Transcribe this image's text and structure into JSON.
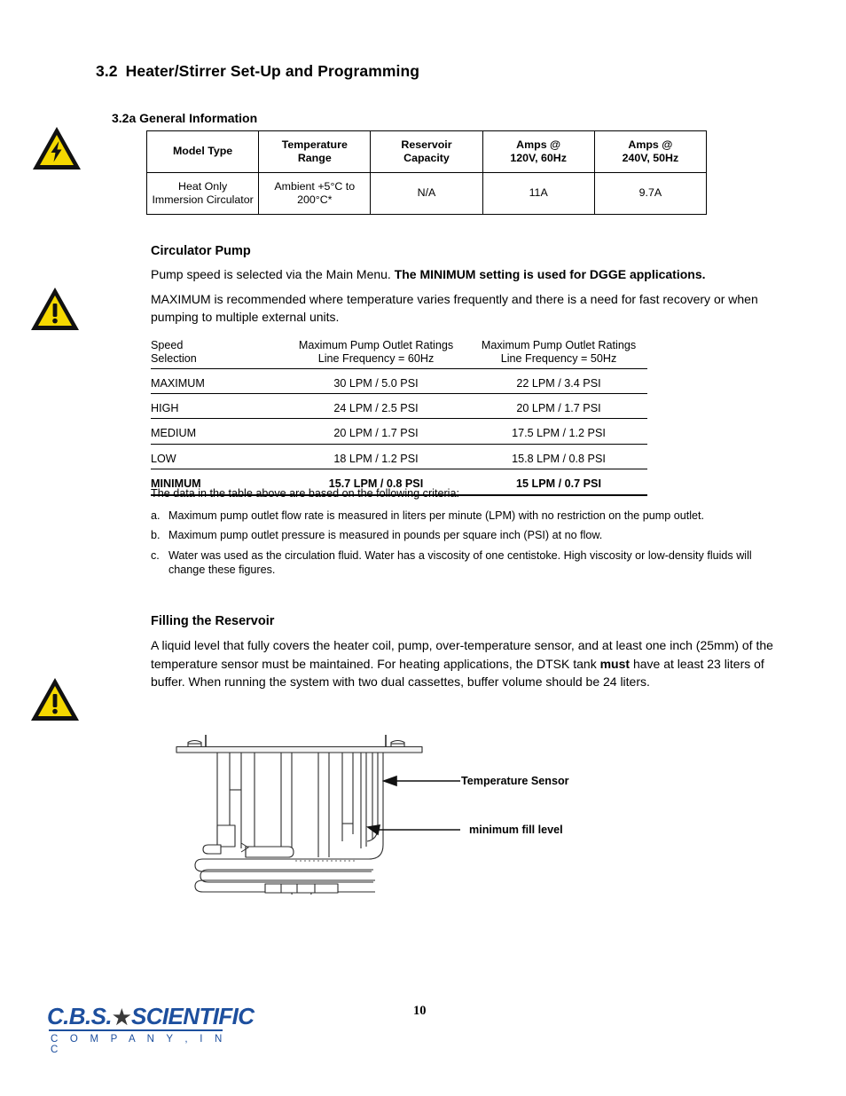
{
  "section": {
    "number": "3.2",
    "title": "Heater/Stirrer Set-Up and Programming",
    "subsection": "3.2a General Information"
  },
  "icons": {
    "electrical_hazard": "high-voltage-warning-icon",
    "general_warning": "exclamation-warning-icon"
  },
  "general_info_table": {
    "headers": [
      "Model Type",
      "Temperature\nRange",
      "Reservoir\nCapacity",
      "Amps @\n120V, 60Hz",
      "Amps @\n240V, 50Hz"
    ],
    "header_lines": [
      [
        "Model Type",
        ""
      ],
      [
        "Temperature",
        "Range"
      ],
      [
        "Reservoir",
        "Capacity"
      ],
      [
        "Amps @",
        "120V, 60Hz"
      ],
      [
        "Amps @",
        "240V, 50Hz"
      ]
    ],
    "rows": [
      {
        "model_line1": "Heat Only",
        "model_line2": "Immersion Circulator",
        "temp_line1": "Ambient +5°C to",
        "temp_line2": "200°C*",
        "reservoir": "N/A",
        "amps_120": "11A",
        "amps_240": "9.7A"
      }
    ]
  },
  "circulator_pump": {
    "heading": "Circulator Pump",
    "para1_normal": "Pump speed is selected via the Main Menu. ",
    "para1_bold": "The MINIMUM setting is used for DGGE applications.",
    "para2": "MAXIMUM is recommended where temperature varies frequently and there is a need for fast recovery or when pumping to multiple external units."
  },
  "pump_table": {
    "header": {
      "col1_line1": "Speed",
      "col1_line2": "Selection",
      "col2_line1": "Maximum Pump Outlet Ratings",
      "col2_line2": "Line Frequency = 60Hz",
      "col3_line1": "Maximum Pump Outlet Ratings",
      "col3_line2": "Line Frequency = 50Hz"
    },
    "rows": [
      {
        "speed": "MAXIMUM",
        "hz60": "30 LPM / 5.0 PSI",
        "hz50": "22 LPM / 3.4 PSI"
      },
      {
        "speed": "HIGH",
        "hz60": "24 LPM / 2.5 PSI",
        "hz50": "20 LPM / 1.7 PSI"
      },
      {
        "speed": "MEDIUM",
        "hz60": "20 LPM / 1.7 PSI",
        "hz50": "17.5 LPM / 1.2 PSI"
      },
      {
        "speed": "LOW",
        "hz60": "18 LPM / 1.2 PSI",
        "hz50": "15.8 LPM / 0.8 PSI"
      },
      {
        "speed": "MINIMUM",
        "hz60": "15.7 LPM / 0.8 PSI",
        "hz50": "15 LPM / 0.7 PSI"
      }
    ]
  },
  "criteria": {
    "intro": "The data in the table above are based on the following criteria:",
    "items": [
      {
        "marker": "a.",
        "text": "Maximum pump outlet flow rate is measured in liters per minute (LPM) with no restriction on the pump outlet."
      },
      {
        "marker": "b.",
        "text": "Maximum pump outlet pressure is measured in pounds per square inch (PSI) at no flow."
      },
      {
        "marker": "c.",
        "text": "Water was used as the circulation fluid. Water has a viscosity of one centistoke. High viscosity or low-density fluids will change these figures."
      }
    ]
  },
  "filling_reservoir": {
    "heading": "Filling the Reservoir",
    "para_part1": "A liquid level that fully covers the heater coil, pump, over-temperature sensor, and at least one inch (25mm) of the temperature sensor must be maintained.   For heating applications, the DTSK tank ",
    "para_bold": "must",
    "para_part2": " have at least 23 liters of buffer.  When running the system with two dual cassettes, buffer volume should be 24 liters."
  },
  "diagram": {
    "labels": {
      "temperature_sensor": "Temperature Sensor",
      "minimum_fill_level": "minimum fill level"
    }
  },
  "footer": {
    "logo_main": "C.B.S.",
    "logo_star": "★",
    "logo_secondary": "SCIENTIFIC",
    "logo_sub": "C O M P A N Y ,   I N C",
    "page_number": "10"
  },
  "colors": {
    "logo_blue": "#1d4f9e",
    "warning_yellow": "#f5d800",
    "warning_black": "#111111"
  }
}
